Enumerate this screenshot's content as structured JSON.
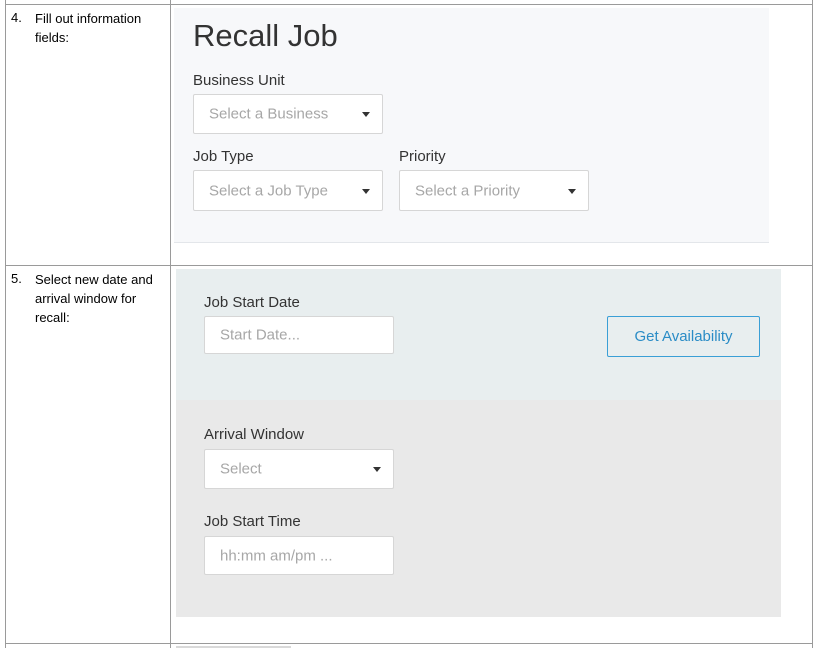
{
  "steps": [
    {
      "number": "4.",
      "text": "Fill out information fields:"
    },
    {
      "number": "5.",
      "text": "Select new date and arrival window for recall:"
    }
  ],
  "recall_form": {
    "title": "Recall Job",
    "business_unit": {
      "label": "Business Unit",
      "placeholder": "Select a Business"
    },
    "job_type": {
      "label": "Job Type",
      "placeholder": "Select a Job Type"
    },
    "priority": {
      "label": "Priority",
      "placeholder": "Select a Priority"
    }
  },
  "schedule_form": {
    "job_start_date": {
      "label": "Job Start Date",
      "placeholder": "Start Date..."
    },
    "get_availability_label": "Get Availability",
    "arrival_window": {
      "label": "Arrival Window",
      "placeholder": "Select"
    },
    "job_start_time": {
      "label": "Job Start Time",
      "placeholder": "hh:mm am/pm ..."
    }
  },
  "colors": {
    "recall_panel_bg": "#f7f8fa",
    "date_panel_bg": "#e8eeef",
    "arrival_panel_bg": "#e9e9e9",
    "accent_blue": "#3a9fd6"
  }
}
